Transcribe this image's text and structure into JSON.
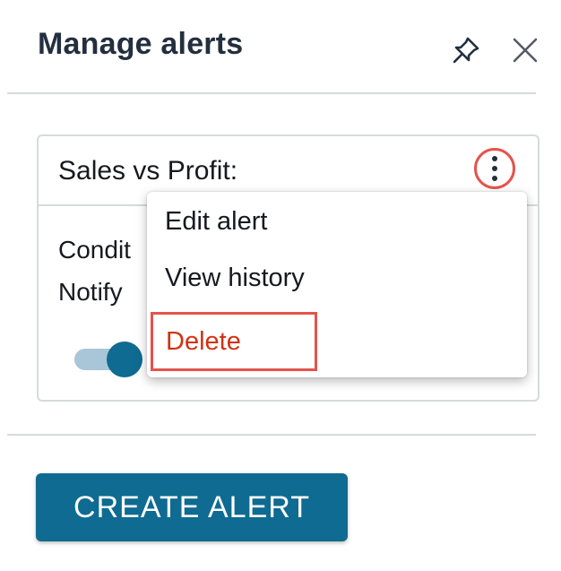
{
  "panel": {
    "title": "Manage alerts",
    "pin_icon": "pin-icon",
    "close_icon": "close-icon"
  },
  "alert_card": {
    "title": "Sales vs Profit:",
    "menu_icon": "kebab-menu-icon",
    "condition_text": "Condit",
    "notify_text": "Notify",
    "toggle_on": true
  },
  "menu": {
    "items": [
      {
        "label": "Edit alert"
      },
      {
        "label": "View history"
      },
      {
        "label": "Delete"
      }
    ]
  },
  "footer": {
    "create_label": "CREATE ALERT"
  },
  "colors": {
    "primary": "#0f6b91",
    "danger": "#d13212",
    "highlight": "#e5534b",
    "border": "#d5dbdb"
  }
}
